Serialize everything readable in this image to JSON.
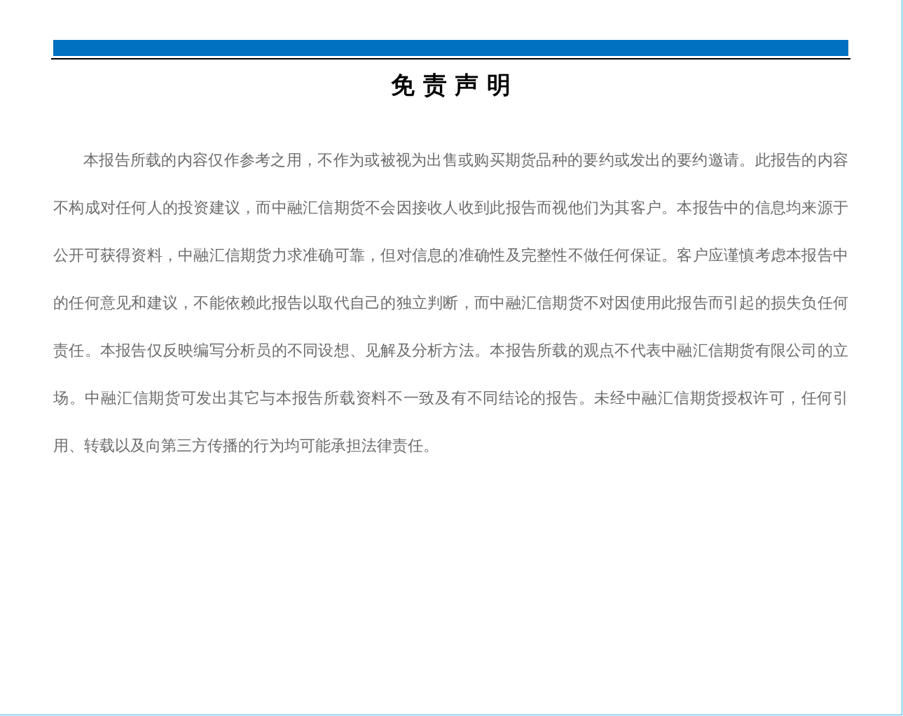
{
  "page": {
    "title": "免 责 声 明",
    "paragraph": "本报告所载的内容仅作参考之用，不作为或被视为出售或购买期货品种的要约或发出的要约邀请。此报告的内容不构成对任何人的投资建议，而中融汇信期货不会因接收人收到此报告而视他们为其客户。本报告中的信息均来源于公开可获得资料，中融汇信期货力求准确可靠，但对信息的准确性及完整性不做任何保证。客户应谨慎考虑本报告中的任何意见和建议，不能依赖此报告以取代自己的独立判断，而中融汇信期货不对因使用此报告而引起的损失负任何责任。本报告仅反映编写分析员的不同设想、见解及分析方法。本报告所载的观点不代表中融汇信期货有限公司的立场。中融汇信期货可发出其它与本报告所载资料不一致及有不同结论的报告。未经中融汇信期货授权许可，任何引用、转载以及向第三方传播的行为均可能承担法律责任。"
  }
}
